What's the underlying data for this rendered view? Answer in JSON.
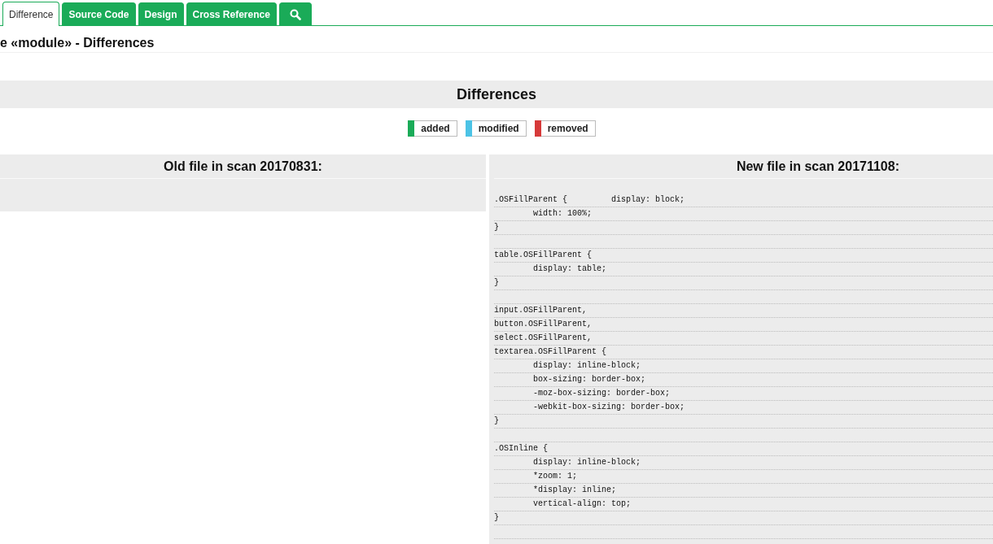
{
  "tabs": [
    {
      "label": "Difference",
      "selected": true,
      "kind": "text"
    },
    {
      "label": "Source Code",
      "selected": false,
      "kind": "text"
    },
    {
      "label": "Design",
      "selected": false,
      "kind": "text"
    },
    {
      "label": "Cross Reference",
      "selected": false,
      "kind": "text"
    },
    {
      "selected": false,
      "kind": "search"
    }
  ],
  "page_title": "e «module» - Differences",
  "section_title": "Differences",
  "legend": [
    {
      "label": "added",
      "color": "#1aab58"
    },
    {
      "label": "modified",
      "color": "#4cc3e6"
    },
    {
      "label": "removed",
      "color": "#d63a3a"
    }
  ],
  "old_file": {
    "heading": "Old file in scan 20170831:"
  },
  "new_file": {
    "heading": "New file in scan 20171108:",
    "lines": [
      {
        "kind": "code",
        "text": ".OSFillParent {\t\tdisplay: block;"
      },
      {
        "kind": "code",
        "text": "\twidth: 100%;"
      },
      {
        "kind": "code",
        "text": "}"
      },
      {
        "kind": "blank"
      },
      {
        "kind": "code",
        "text": "table.OSFillParent {"
      },
      {
        "kind": "code",
        "text": "\tdisplay: table;"
      },
      {
        "kind": "code",
        "text": "}"
      },
      {
        "kind": "blank"
      },
      {
        "kind": "code",
        "text": "input.OSFillParent,"
      },
      {
        "kind": "code",
        "text": "button.OSFillParent,"
      },
      {
        "kind": "code",
        "text": "select.OSFillParent,"
      },
      {
        "kind": "code",
        "text": "textarea.OSFillParent {"
      },
      {
        "kind": "code",
        "text": "\tdisplay: inline-block;"
      },
      {
        "kind": "code",
        "text": "\tbox-sizing: border-box;"
      },
      {
        "kind": "code",
        "text": "\t-moz-box-sizing: border-box;"
      },
      {
        "kind": "code",
        "text": "\t-webkit-box-sizing: border-box;"
      },
      {
        "kind": "code",
        "text": "}"
      },
      {
        "kind": "blank"
      },
      {
        "kind": "code",
        "text": ".OSInline {"
      },
      {
        "kind": "code",
        "text": "\tdisplay: inline-block;"
      },
      {
        "kind": "code",
        "text": "\t*zoom: 1;"
      },
      {
        "kind": "code",
        "text": "\t*display: inline;"
      },
      {
        "kind": "code",
        "text": "\tvertical-align: top;"
      },
      {
        "kind": "code",
        "text": "}"
      },
      {
        "kind": "blank"
      }
    ]
  }
}
